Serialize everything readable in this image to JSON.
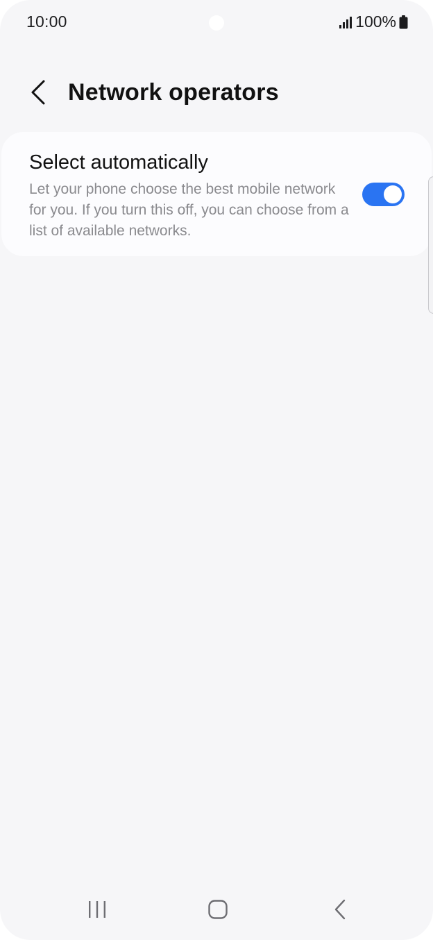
{
  "status_bar": {
    "time": "10:00",
    "battery": "100%",
    "icons": [
      "signal-icon",
      "battery-icon"
    ]
  },
  "header": {
    "title": "Network operators",
    "back_icon": "chevron-left-icon"
  },
  "setting": {
    "title": "Select automatically",
    "description": "Let your phone choose the best mobile network for you. If you turn this off, you can choose from a list of available networks.",
    "toggle_on": true
  },
  "nav_bar": {
    "icons": [
      "recents-icon",
      "home-icon",
      "back-icon"
    ]
  },
  "colors": {
    "background": "#f6f6f8",
    "card": "#fcfcfe",
    "accent": "#2a74f2",
    "title_text": "#111111",
    "secondary_text": "#8a8a8e"
  }
}
